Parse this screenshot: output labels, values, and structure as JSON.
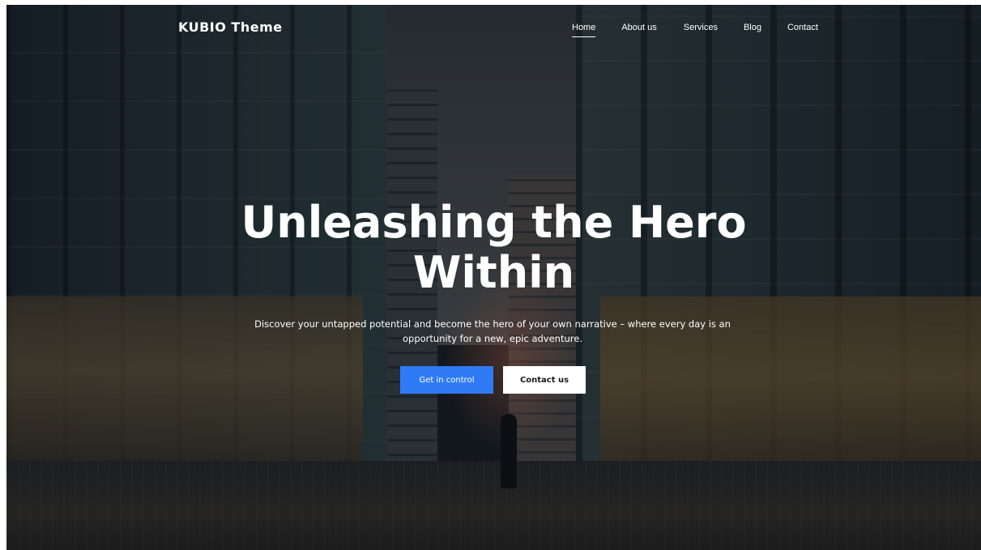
{
  "header": {
    "logo": "KUBIO Theme",
    "nav": [
      {
        "label": "Home",
        "active": true
      },
      {
        "label": "About us",
        "active": false
      },
      {
        "label": "Services",
        "active": false
      },
      {
        "label": "Blog",
        "active": false
      },
      {
        "label": "Contact",
        "active": false
      }
    ]
  },
  "hero": {
    "title_line1": "Unleashing the Hero",
    "title_line2": "Within",
    "subtitle_line1": "Discover your untapped potential and become the hero of your own narrative – where every day is an",
    "subtitle_line2": "opportunity for a new, epic adventure.",
    "primary_button": "Get in control",
    "secondary_button": "Contact us"
  },
  "colors": {
    "primary": "#2f7bf5",
    "secondary_bg": "#ffffff",
    "text": "#ffffff"
  },
  "background": {
    "image_subject": "night-city-street-photo"
  }
}
